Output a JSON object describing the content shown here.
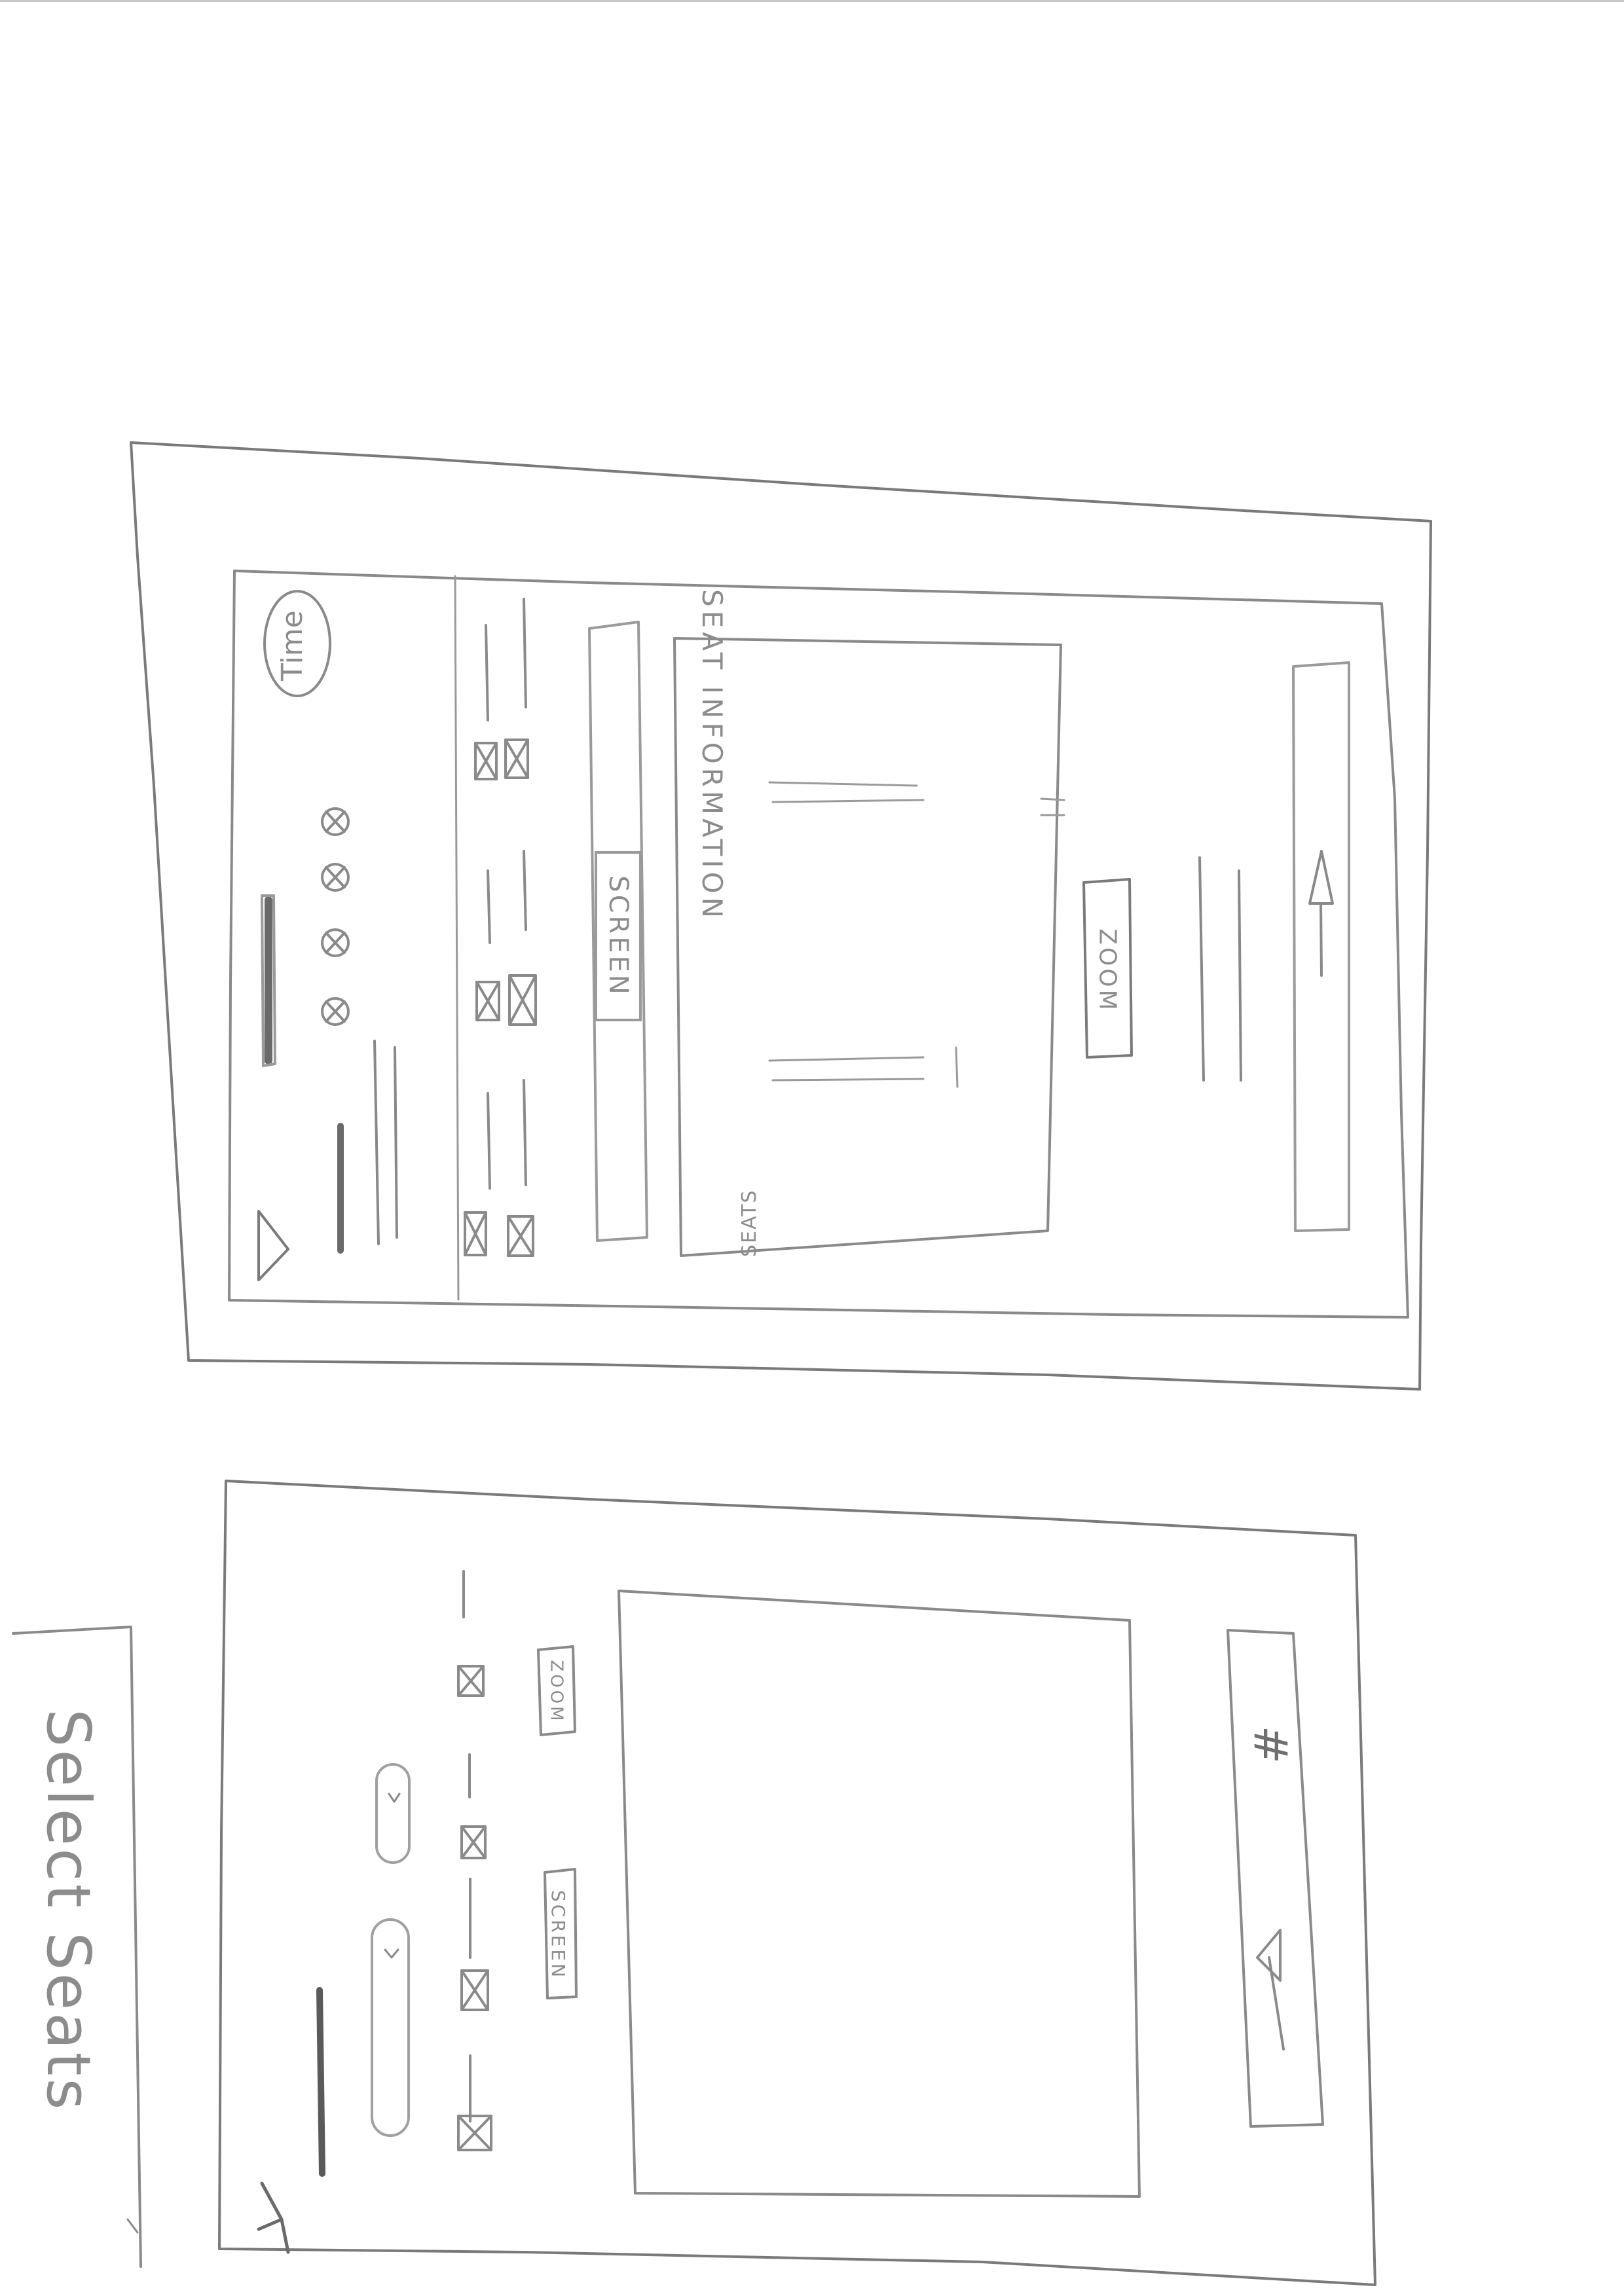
{
  "sketch1": {
    "time_label": "Time",
    "screen_label": "SCREEN",
    "zoom_label": "ZOOM",
    "top_label": "SEAT INFORMATION",
    "rows_label": "SEATS"
  },
  "sketch2": {
    "title": "Select Seats",
    "screen_label": "SCREEN",
    "zoom_label": "ZOOM",
    "hash_label": "#",
    "dropdown_marker": "v"
  },
  "colors": {
    "pencil": "#8a8a8a",
    "pencil_dark": "#6e6e6e",
    "paper": "#ffffff"
  }
}
